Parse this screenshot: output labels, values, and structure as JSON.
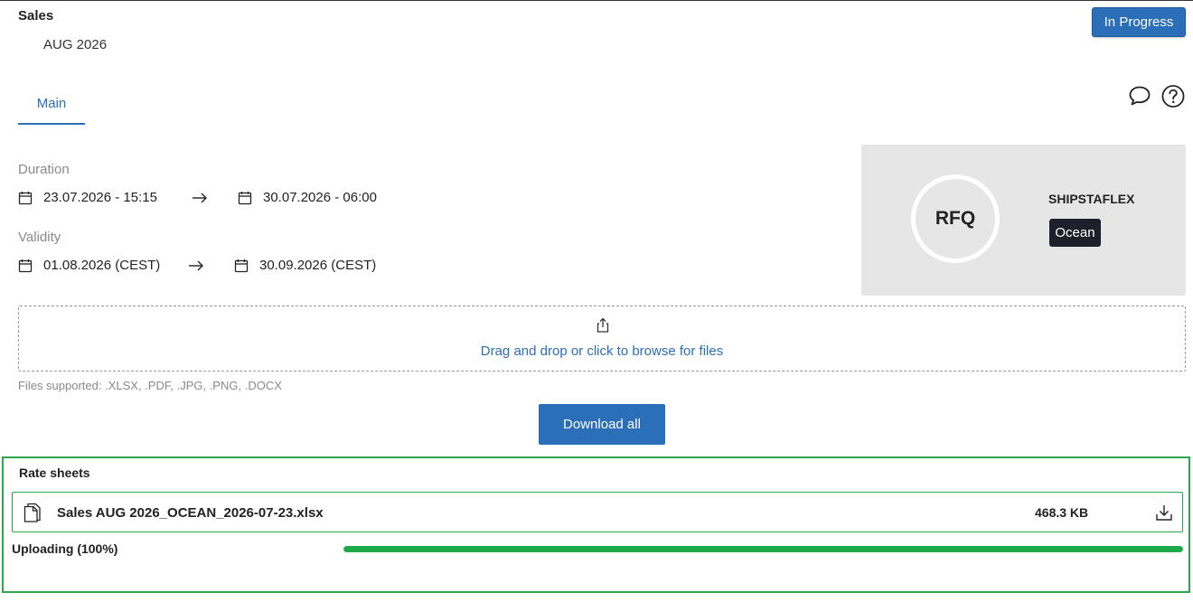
{
  "header": {
    "section_title": "Sales",
    "subtitle": "AUG 2026",
    "status_label": "In Progress"
  },
  "tabs": [
    {
      "label": "Main",
      "active": true
    }
  ],
  "icons": {
    "chat": "speech-bubble-icon",
    "help": "question-circle-icon"
  },
  "duration": {
    "label": "Duration",
    "start": "23.07.2026 - 15:15",
    "end": "30.07.2026 - 06:00"
  },
  "validity": {
    "label": "Validity",
    "start": "01.08.2026 (CEST)",
    "end": "30.09.2026 (CEST)"
  },
  "rfq_card": {
    "type_label": "RFQ",
    "company": "SHIPSTAFLEX",
    "mode": "Ocean"
  },
  "dropzone": {
    "text": "Drag and drop or click to browse for files",
    "supported": "Files supported: .XLSX, .PDF, .JPG, .PNG, .DOCX"
  },
  "actions": {
    "download_all_label": "Download all"
  },
  "rate_sheets": {
    "title": "Rate sheets",
    "files": [
      {
        "name": "Sales AUG 2026_OCEAN_2026-07-23.xlsx",
        "size": "468.3 KB",
        "status": "Uploading (100%)",
        "progress": 1.0
      }
    ]
  },
  "colors": {
    "primary": "#2a6fb8",
    "success": "#1fa84a",
    "card_bg": "#e6e6e6",
    "badge_bg": "#1f1f2b"
  }
}
